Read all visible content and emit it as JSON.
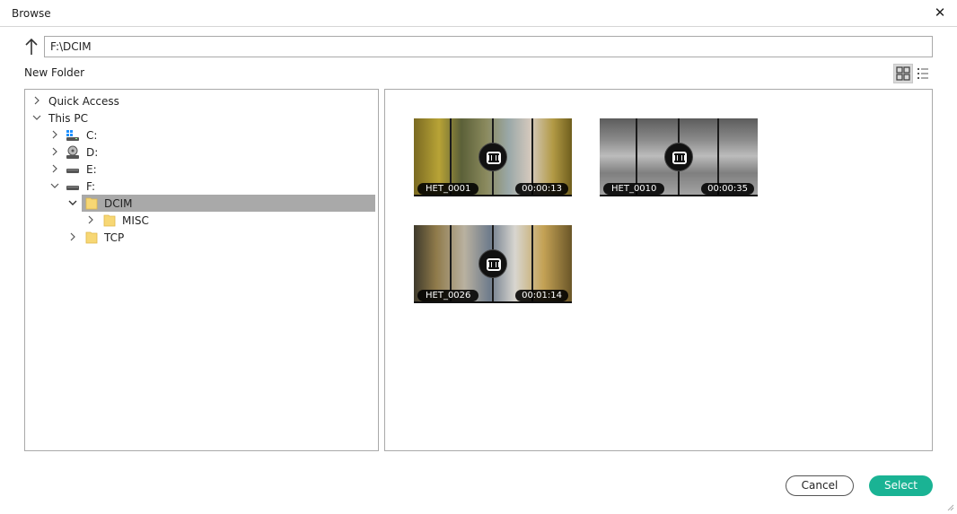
{
  "window": {
    "title": "Browse",
    "close_glyph": "✕"
  },
  "toolbar": {
    "up_icon": "arrow-up-icon",
    "path_value": "F:\\DCIM",
    "new_folder_label": "New Folder",
    "view_modes": [
      "grid-view-icon",
      "list-view-icon"
    ],
    "active_view": "grid"
  },
  "tree": {
    "items": [
      {
        "label": "Quick Access",
        "expanded": false,
        "icon": "none",
        "depth": 0
      },
      {
        "label": "This PC",
        "expanded": true,
        "icon": "none",
        "depth": 0
      },
      {
        "label": "C:",
        "expanded": false,
        "icon": "windows-drive-icon",
        "depth": 1
      },
      {
        "label": "D:",
        "expanded": false,
        "icon": "optical-drive-icon",
        "depth": 1
      },
      {
        "label": "E:",
        "expanded": false,
        "icon": "drive-icon",
        "depth": 1
      },
      {
        "label": "F:",
        "expanded": true,
        "icon": "drive-icon",
        "depth": 1
      },
      {
        "label": "DCIM",
        "expanded": true,
        "icon": "folder-icon",
        "depth": 2,
        "selected": true
      },
      {
        "label": "MISC",
        "expanded": false,
        "icon": "folder-icon",
        "depth": 3
      },
      {
        "label": "TCP",
        "expanded": false,
        "icon": "folder-icon",
        "depth": 2
      }
    ]
  },
  "files": [
    {
      "name": "HET_0001",
      "duration": "00:00:13"
    },
    {
      "name": "HET_0010",
      "duration": "00:00:35"
    },
    {
      "name": "HET_0026",
      "duration": "00:01:14"
    }
  ],
  "buttons": {
    "cancel_label": "Cancel",
    "select_label": "Select"
  },
  "colors": {
    "accent": "#1ab394",
    "selection": "#a9a9a9",
    "folder": "#f7d774"
  }
}
